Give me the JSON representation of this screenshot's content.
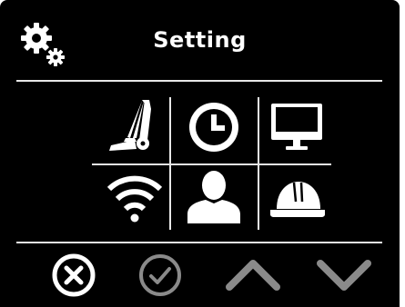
{
  "header": {
    "title": "Setting",
    "icon": "gears-icon"
  },
  "menu": {
    "rows": [
      [
        {
          "id": "vacuum",
          "icon": "vacuum-cleaner-icon"
        },
        {
          "id": "clock",
          "icon": "clock-icon"
        },
        {
          "id": "display",
          "icon": "monitor-icon"
        }
      ],
      [
        {
          "id": "wifi",
          "icon": "wifi-icon"
        },
        {
          "id": "user",
          "icon": "user-icon"
        },
        {
          "id": "maintenance",
          "icon": "hard-hat-icon"
        }
      ]
    ]
  },
  "footer": {
    "buttons": [
      {
        "id": "cancel",
        "icon": "cancel-x-icon",
        "state": "active"
      },
      {
        "id": "confirm",
        "icon": "check-icon",
        "state": "disabled"
      },
      {
        "id": "up",
        "icon": "chevron-up-icon",
        "state": "disabled"
      },
      {
        "id": "down",
        "icon": "chevron-down-icon",
        "state": "disabled"
      }
    ]
  },
  "colors": {
    "background": "#000000",
    "foreground": "#ffffff",
    "divider": "#e8e8e8",
    "disabled": "#8a8a8a"
  }
}
